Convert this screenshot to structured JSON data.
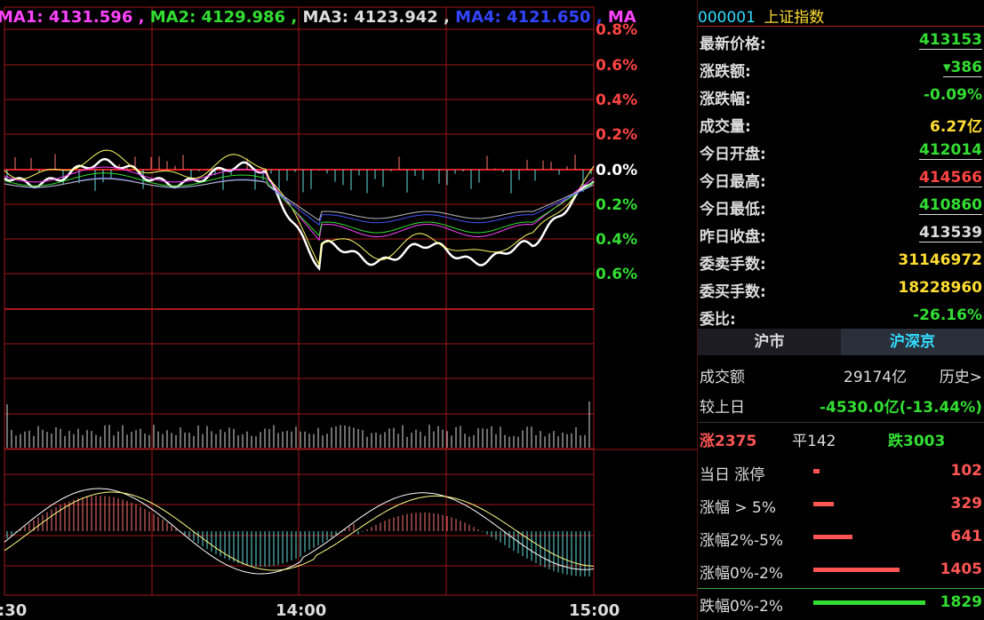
{
  "chart": {
    "ma_labels": [
      {
        "text": "MA1: 4131.596",
        "color": "#ff44ff"
      },
      {
        "text": "MA2: 4129.986",
        "color": "#33dd33"
      },
      {
        "text": "MA3: 4123.942",
        "color": "#dddddd"
      },
      {
        "text": "MA4: 4121.650",
        "color": "#3344ff"
      },
      {
        "text": "MA",
        "color": "#ff44ff"
      }
    ],
    "pct_axis": [
      {
        "text": "0.8%",
        "color": "#ff4444"
      },
      {
        "text": "0.6%",
        "color": "#ff4444"
      },
      {
        "text": "0.4%",
        "color": "#ff4444"
      },
      {
        "text": "0.2%",
        "color": "#ff4444"
      },
      {
        "text": "0.0%",
        "color": "#ffffff"
      },
      {
        "text": "0.2%",
        "color": "#33dd33"
      },
      {
        "text": "0.4%",
        "color": "#33dd33"
      },
      {
        "text": "0.6%",
        "color": "#33dd33"
      }
    ],
    "time_labels": [
      ":30",
      "14:00",
      "15:00"
    ]
  },
  "quote": {
    "code": "000001",
    "name": "上证指数",
    "rows": [
      {
        "label": "最新价格:",
        "value": "413153",
        "color": "#33dd33",
        "underline": true
      },
      {
        "label": "涨跌额:",
        "value": "386",
        "prefix": "▾",
        "color": "#33dd33",
        "underline": true
      },
      {
        "label": "涨跌幅:",
        "value": "-0.09%",
        "color": "#33dd33",
        "underline": false
      },
      {
        "label": "成交量:",
        "value": "6.27亿",
        "color": "#ffdd33",
        "underline": false
      },
      {
        "label": "今日开盘:",
        "value": "412014",
        "color": "#33dd33",
        "underline": true
      },
      {
        "label": "今日最高:",
        "value": "414566",
        "color": "#ff4444",
        "underline": true
      },
      {
        "label": "今日最低:",
        "value": "410860",
        "color": "#33dd33",
        "underline": true
      },
      {
        "label": "昨日收盘:",
        "value": "413539",
        "color": "#dddddd",
        "underline": true
      },
      {
        "label": "委卖手数:",
        "value": "31146972",
        "color": "#ffdd33",
        "underline": false
      },
      {
        "label": "委买手数:",
        "value": "18228960",
        "color": "#ffdd33",
        "underline": false
      },
      {
        "label": "委比:",
        "value": "-26.16%",
        "color": "#33dd33",
        "underline": false
      }
    ]
  },
  "market": {
    "tabs": [
      "沪市",
      "沪深京"
    ],
    "turnover_label": "成交额",
    "turnover_value": "29174亿",
    "history_link": "历史>",
    "compare_label": "较上日",
    "compare_value": "-4530.0亿(-13.44%)",
    "up_count": "涨2375",
    "flat_count": "平142",
    "down_count": "跌3003",
    "breakdown": [
      {
        "label": "当日 涨停",
        "value": "102",
        "color": "#ff5555",
        "fill": 0.056
      },
      {
        "label": "涨幅 > 5%",
        "value": "329",
        "color": "#ff5555",
        "fill": 0.18
      },
      {
        "label": "涨幅2%-5%",
        "value": "641",
        "color": "#ff5555",
        "fill": 0.35
      },
      {
        "label": "涨幅0%-2%",
        "value": "1405",
        "color": "#ff5555",
        "fill": 0.77
      },
      {
        "label": "跌幅0%-2%",
        "value": "1829",
        "color": "#33dd33",
        "fill": 1.0
      }
    ]
  }
}
